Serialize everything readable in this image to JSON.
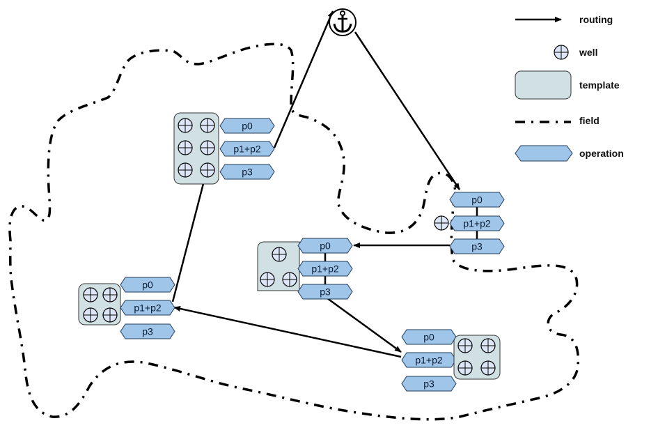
{
  "colors": {
    "operation_fill": "#9fc5e8",
    "operation_stroke": "#1f3a5a",
    "template_fill": "#d0e0e3",
    "well_fill": "#dde6f7",
    "line": "#000000"
  },
  "operations": {
    "p0": "p0",
    "p12": "p1+p2",
    "p3": "p3"
  },
  "legend": {
    "routing": "routing",
    "well": "well",
    "template": "template",
    "field": "field",
    "operation": "operation"
  },
  "anchor_icon": "anchor-icon"
}
